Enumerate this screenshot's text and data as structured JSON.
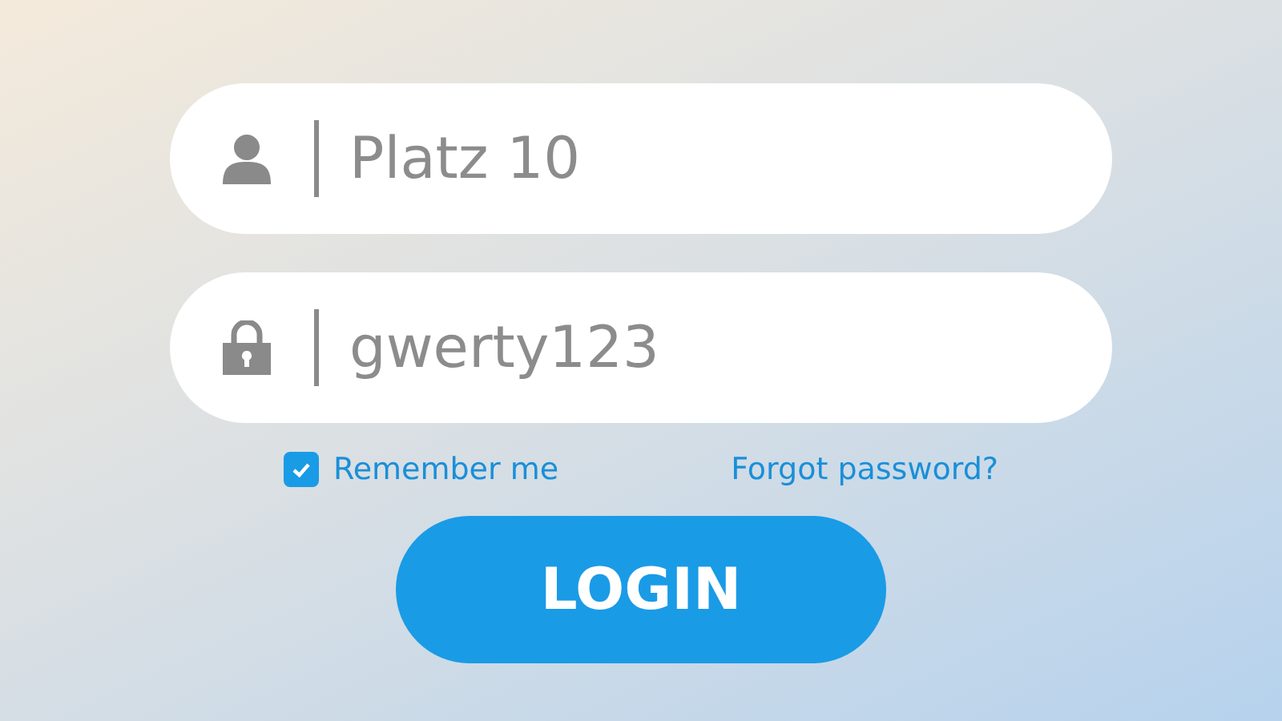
{
  "fields": [
    {
      "kind": "user",
      "value": "Platz 10"
    },
    {
      "kind": "lock",
      "value": "gwerty123"
    }
  ],
  "remember": {
    "label": "Remember me",
    "checked": true
  },
  "forgot_link": "Forgot password?",
  "login_button": "LOGIN"
}
